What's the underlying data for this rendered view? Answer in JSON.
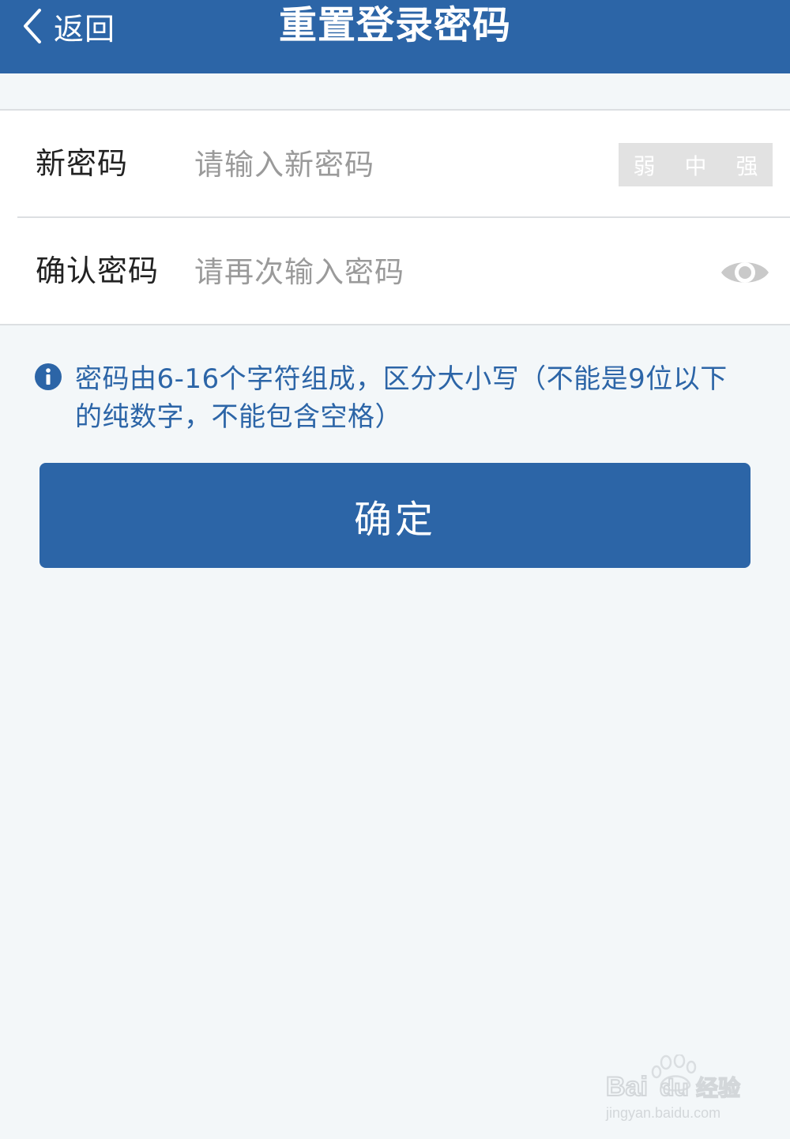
{
  "header": {
    "back_label": "返回",
    "title": "重置登录密码"
  },
  "form": {
    "new_password": {
      "label": "新密码",
      "placeholder": "请输入新密码",
      "value": ""
    },
    "strength": {
      "levels": [
        "弱",
        "中",
        "强"
      ]
    },
    "confirm_password": {
      "label": "确认密码",
      "placeholder": "请再次输入密码",
      "value": ""
    }
  },
  "hint": {
    "text": "密码由6-16个字符组成，区分大小写（不能是9位以下的纯数字，不能包含空格）"
  },
  "confirm_button": {
    "label": "确定"
  },
  "watermark": {
    "brand": "Baidu经验",
    "url": "jingyan.baidu.com"
  },
  "colors": {
    "primary": "#2c65a7",
    "background": "#f3f7f9",
    "strength_bg": "#e2e2e2",
    "placeholder": "#9a9a9a"
  }
}
